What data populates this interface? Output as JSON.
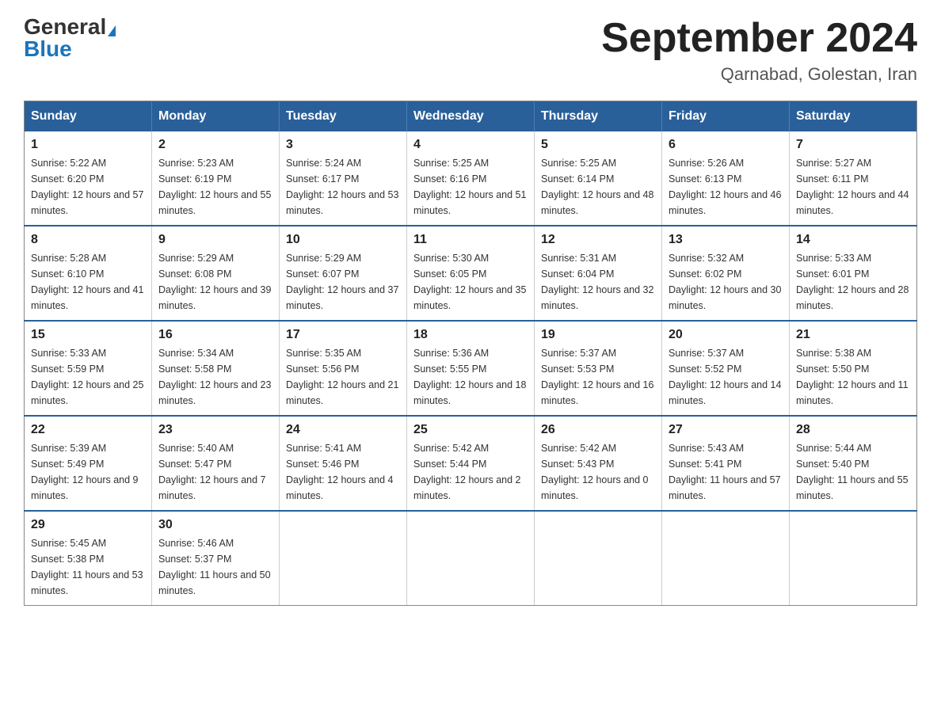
{
  "logo": {
    "general": "General",
    "blue": "Blue",
    "triangle": true
  },
  "title": "September 2024",
  "subtitle": "Qarnabad, Golestan, Iran",
  "days_of_week": [
    "Sunday",
    "Monday",
    "Tuesday",
    "Wednesday",
    "Thursday",
    "Friday",
    "Saturday"
  ],
  "weeks": [
    [
      {
        "day": "1",
        "sunrise": "5:22 AM",
        "sunset": "6:20 PM",
        "daylight": "12 hours and 57 minutes."
      },
      {
        "day": "2",
        "sunrise": "5:23 AM",
        "sunset": "6:19 PM",
        "daylight": "12 hours and 55 minutes."
      },
      {
        "day": "3",
        "sunrise": "5:24 AM",
        "sunset": "6:17 PM",
        "daylight": "12 hours and 53 minutes."
      },
      {
        "day": "4",
        "sunrise": "5:25 AM",
        "sunset": "6:16 PM",
        "daylight": "12 hours and 51 minutes."
      },
      {
        "day": "5",
        "sunrise": "5:25 AM",
        "sunset": "6:14 PM",
        "daylight": "12 hours and 48 minutes."
      },
      {
        "day": "6",
        "sunrise": "5:26 AM",
        "sunset": "6:13 PM",
        "daylight": "12 hours and 46 minutes."
      },
      {
        "day": "7",
        "sunrise": "5:27 AM",
        "sunset": "6:11 PM",
        "daylight": "12 hours and 44 minutes."
      }
    ],
    [
      {
        "day": "8",
        "sunrise": "5:28 AM",
        "sunset": "6:10 PM",
        "daylight": "12 hours and 41 minutes."
      },
      {
        "day": "9",
        "sunrise": "5:29 AM",
        "sunset": "6:08 PM",
        "daylight": "12 hours and 39 minutes."
      },
      {
        "day": "10",
        "sunrise": "5:29 AM",
        "sunset": "6:07 PM",
        "daylight": "12 hours and 37 minutes."
      },
      {
        "day": "11",
        "sunrise": "5:30 AM",
        "sunset": "6:05 PM",
        "daylight": "12 hours and 35 minutes."
      },
      {
        "day": "12",
        "sunrise": "5:31 AM",
        "sunset": "6:04 PM",
        "daylight": "12 hours and 32 minutes."
      },
      {
        "day": "13",
        "sunrise": "5:32 AM",
        "sunset": "6:02 PM",
        "daylight": "12 hours and 30 minutes."
      },
      {
        "day": "14",
        "sunrise": "5:33 AM",
        "sunset": "6:01 PM",
        "daylight": "12 hours and 28 minutes."
      }
    ],
    [
      {
        "day": "15",
        "sunrise": "5:33 AM",
        "sunset": "5:59 PM",
        "daylight": "12 hours and 25 minutes."
      },
      {
        "day": "16",
        "sunrise": "5:34 AM",
        "sunset": "5:58 PM",
        "daylight": "12 hours and 23 minutes."
      },
      {
        "day": "17",
        "sunrise": "5:35 AM",
        "sunset": "5:56 PM",
        "daylight": "12 hours and 21 minutes."
      },
      {
        "day": "18",
        "sunrise": "5:36 AM",
        "sunset": "5:55 PM",
        "daylight": "12 hours and 18 minutes."
      },
      {
        "day": "19",
        "sunrise": "5:37 AM",
        "sunset": "5:53 PM",
        "daylight": "12 hours and 16 minutes."
      },
      {
        "day": "20",
        "sunrise": "5:37 AM",
        "sunset": "5:52 PM",
        "daylight": "12 hours and 14 minutes."
      },
      {
        "day": "21",
        "sunrise": "5:38 AM",
        "sunset": "5:50 PM",
        "daylight": "12 hours and 11 minutes."
      }
    ],
    [
      {
        "day": "22",
        "sunrise": "5:39 AM",
        "sunset": "5:49 PM",
        "daylight": "12 hours and 9 minutes."
      },
      {
        "day": "23",
        "sunrise": "5:40 AM",
        "sunset": "5:47 PM",
        "daylight": "12 hours and 7 minutes."
      },
      {
        "day": "24",
        "sunrise": "5:41 AM",
        "sunset": "5:46 PM",
        "daylight": "12 hours and 4 minutes."
      },
      {
        "day": "25",
        "sunrise": "5:42 AM",
        "sunset": "5:44 PM",
        "daylight": "12 hours and 2 minutes."
      },
      {
        "day": "26",
        "sunrise": "5:42 AM",
        "sunset": "5:43 PM",
        "daylight": "12 hours and 0 minutes."
      },
      {
        "day": "27",
        "sunrise": "5:43 AM",
        "sunset": "5:41 PM",
        "daylight": "11 hours and 57 minutes."
      },
      {
        "day": "28",
        "sunrise": "5:44 AM",
        "sunset": "5:40 PM",
        "daylight": "11 hours and 55 minutes."
      }
    ],
    [
      {
        "day": "29",
        "sunrise": "5:45 AM",
        "sunset": "5:38 PM",
        "daylight": "11 hours and 53 minutes."
      },
      {
        "day": "30",
        "sunrise": "5:46 AM",
        "sunset": "5:37 PM",
        "daylight": "11 hours and 50 minutes."
      },
      null,
      null,
      null,
      null,
      null
    ]
  ]
}
